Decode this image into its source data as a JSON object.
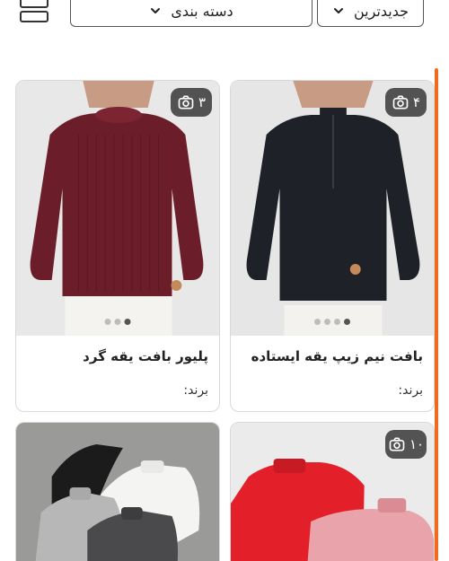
{
  "toolbar": {
    "category_label": "دسته بندی",
    "sort_label": "جدیدترین"
  },
  "products": [
    {
      "title": "بافت نیم زیپ یقه ایستاده",
      "brand_label": "برند:",
      "photo_count": "۴",
      "image": "black-half-zip-sweater",
      "active_dot": 4,
      "dots": 4
    },
    {
      "title": "پلیور بافت یقه گرد",
      "brand_label": "برند:",
      "photo_count": "۳",
      "image": "burgundy-crewneck-sweater",
      "active_dot": 3,
      "dots": 3
    },
    {
      "title": "",
      "brand_label": "",
      "photo_count": "۱۰",
      "image": "red-and-pink-turtlenecks"
    },
    {
      "title": "",
      "brand_label": "",
      "photo_count": "",
      "image": "assorted-turtleneck-sweaters"
    }
  ],
  "icons": {
    "grid_view": "grid-view-icon",
    "chevron": "chevron-down-icon",
    "camera": "camera-icon"
  },
  "colors": {
    "accent": "#f26b1d",
    "badge_bg": "#2a2a2a"
  }
}
